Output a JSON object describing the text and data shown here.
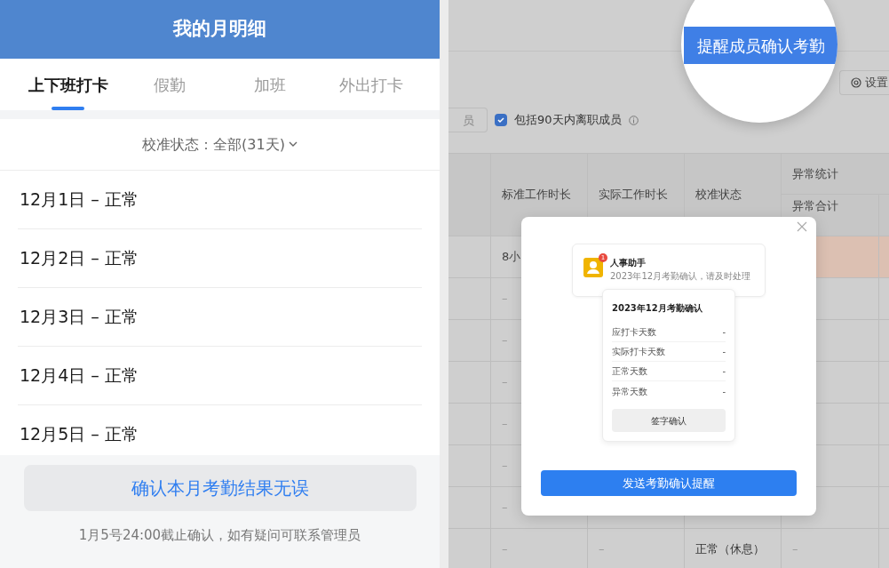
{
  "mobile": {
    "title": "我的月明细",
    "tabs": [
      {
        "label": "上下班打卡",
        "selected": true
      },
      {
        "label": "假勤",
        "selected": false
      },
      {
        "label": "加班",
        "selected": false
      },
      {
        "label": "外出打卡",
        "selected": false
      }
    ],
    "filter": {
      "label": "校准状态：全部(31天)"
    },
    "days": [
      "12月1日 – 正常",
      "12月2日 – 正常",
      "12月3日 – 正常",
      "12月4日 – 正常",
      "12月5日 – 正常"
    ],
    "confirm_button": "确认本月考勤结果无误",
    "note": "1月5号24:00截止确认，如有疑问可联系管理员"
  },
  "admin": {
    "remind_button": "提醒成员确认考勤",
    "settings_button": "设置",
    "member_field": {
      "placeholder": "员"
    },
    "include_departed": {
      "label": "包括90天内离职成员",
      "checked": true
    },
    "columns": [
      "标准工作时长",
      "实际工作时长",
      "校准状态"
    ],
    "group_column": {
      "label": "异常统计",
      "sub_columns": [
        "异常合计"
      ]
    },
    "rows": [
      {
        "standard_hours": "8小",
        "flagged": true
      },
      {
        "standard_hours": "–",
        "flagged": false
      },
      {
        "standard_hours": "–",
        "flagged": false
      },
      {
        "standard_hours": "–",
        "flagged": false
      },
      {
        "standard_hours": "–",
        "flagged": false
      },
      {
        "standard_hours": "–",
        "flagged": false
      },
      {
        "standard_hours": "–",
        "flagged": false
      },
      {
        "standard_hours": "–",
        "actual_hours": "–",
        "status": "正常（休息）",
        "anomaly_total": "–",
        "flagged": false
      }
    ],
    "dialog": {
      "notification": {
        "sender": "人事助手",
        "badge": "1",
        "message": "2023年12月考勤确认，请及时处理"
      },
      "card": {
        "title": "2023年12月考勤确认",
        "stats": [
          {
            "label": "应打卡天数",
            "value": "-"
          },
          {
            "label": "实际打卡天数",
            "value": "-"
          },
          {
            "label": "正常天数",
            "value": "-"
          },
          {
            "label": "异常天数",
            "value": "-"
          }
        ],
        "button": "签字确认"
      },
      "send_button": "发送考勤确认提醒"
    }
  }
}
